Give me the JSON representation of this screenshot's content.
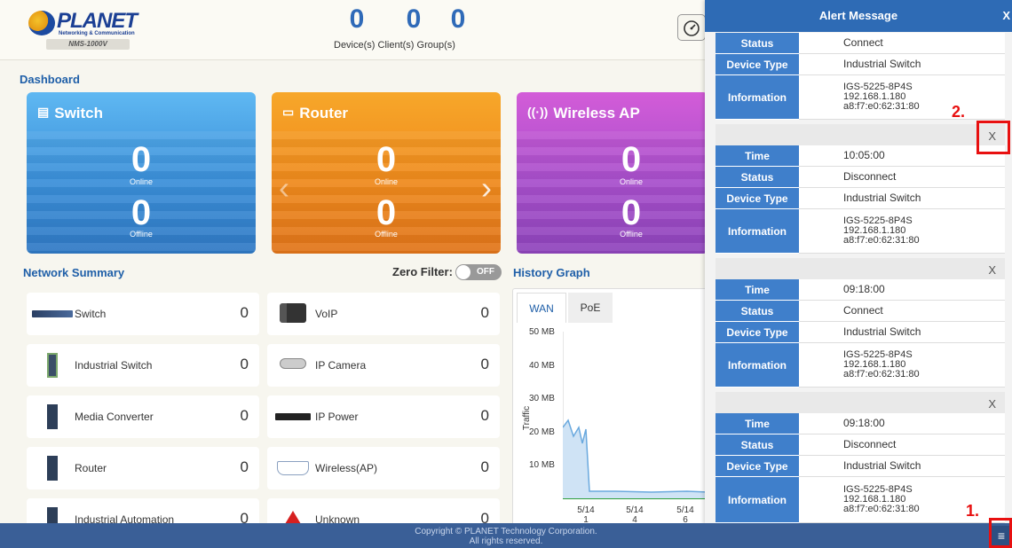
{
  "header": {
    "logo_word": "PLANET",
    "logo_sub": "Networking & Communication",
    "model": "NMS-1000V",
    "counters": [
      {
        "value": "0",
        "label": "Device(s)"
      },
      {
        "value": "0",
        "label": "Client(s)"
      },
      {
        "value": "0",
        "label": "Group(s)"
      }
    ]
  },
  "dashboard": {
    "title": "Dashboard",
    "cards": [
      {
        "title": "Switch",
        "online": "0",
        "online_label": "Online",
        "offline": "0",
        "offline_label": "Offline",
        "color": "#3a8fd9"
      },
      {
        "title": "Router",
        "online": "0",
        "online_label": "Online",
        "offline": "0",
        "offline_label": "Offline",
        "color": "#ef8a1c"
      },
      {
        "title": "Wireless AP",
        "online": "0",
        "online_label": "Online",
        "offline": "0",
        "offline_label": "Offline",
        "color": "#9b47c8"
      }
    ]
  },
  "network_summary": {
    "title": "Network Summary",
    "zero_filter_label": "Zero Filter:",
    "toggle_label": "OFF",
    "left_items": [
      {
        "label": "Switch",
        "count": "0"
      },
      {
        "label": "Industrial Switch",
        "count": "0"
      },
      {
        "label": "Media Converter",
        "count": "0"
      },
      {
        "label": "Router",
        "count": "0"
      },
      {
        "label": "Industrial Automation",
        "count": "0"
      }
    ],
    "right_items": [
      {
        "label": "VoIP",
        "count": "0"
      },
      {
        "label": "IP Camera",
        "count": "0"
      },
      {
        "label": "IP Power",
        "count": "0"
      },
      {
        "label": "Wireless(AP)",
        "count": "0"
      },
      {
        "label": "Unknown",
        "count": "0"
      }
    ]
  },
  "history_graph": {
    "title": "History Graph",
    "tabs": [
      "WAN",
      "PoE"
    ],
    "active_tab": "WAN",
    "y_axis_title": "Traffic",
    "y_ticks": [
      "50 MB",
      "40 MB",
      "30 MB",
      "20 MB",
      "10 MB"
    ],
    "x_ticks": [
      {
        "top": "5/14",
        "bottom": "1"
      },
      {
        "top": "5/14",
        "bottom": "4"
      },
      {
        "top": "5/14",
        "bottom": "6"
      }
    ]
  },
  "alert": {
    "title": "Alert Message",
    "close_label": "X",
    "dismiss_label": "X",
    "first_entry": {
      "status_key": "Status",
      "status": "Connect",
      "type_key": "Device Type",
      "type": "Industrial Switch",
      "info_key": "Information",
      "info": "IGS-5225-8P4S\n192.168.1.180\na8:f7:e0:62:31:80"
    },
    "entries": [
      {
        "time_key": "Time",
        "time": "10:05:00",
        "status_key": "Status",
        "status": "Disconnect",
        "type_key": "Device Type",
        "type": "Industrial Switch",
        "info_key": "Information",
        "info": "IGS-5225-8P4S\n192.168.1.180\na8:f7:e0:62:31:80"
      },
      {
        "time_key": "Time",
        "time": "09:18:00",
        "status_key": "Status",
        "status": "Connect",
        "type_key": "Device Type",
        "type": "Industrial Switch",
        "info_key": "Information",
        "info": "IGS-5225-8P4S\n192.168.1.180\na8:f7:e0:62:31:80"
      },
      {
        "time_key": "Time",
        "time": "09:18:00",
        "status_key": "Status",
        "status": "Disconnect",
        "type_key": "Device Type",
        "type": "Industrial Switch",
        "info_key": "Information",
        "info": "IGS-5225-8P4S\n192.168.1.180\na8:f7:e0:62:31:80"
      }
    ]
  },
  "callouts": {
    "one": "1.",
    "two": "2."
  },
  "footer": {
    "line1": "Copyright © PLANET Technology Corporation.",
    "line2": "All rights reserved."
  },
  "menu_icon": "menu-icon"
}
